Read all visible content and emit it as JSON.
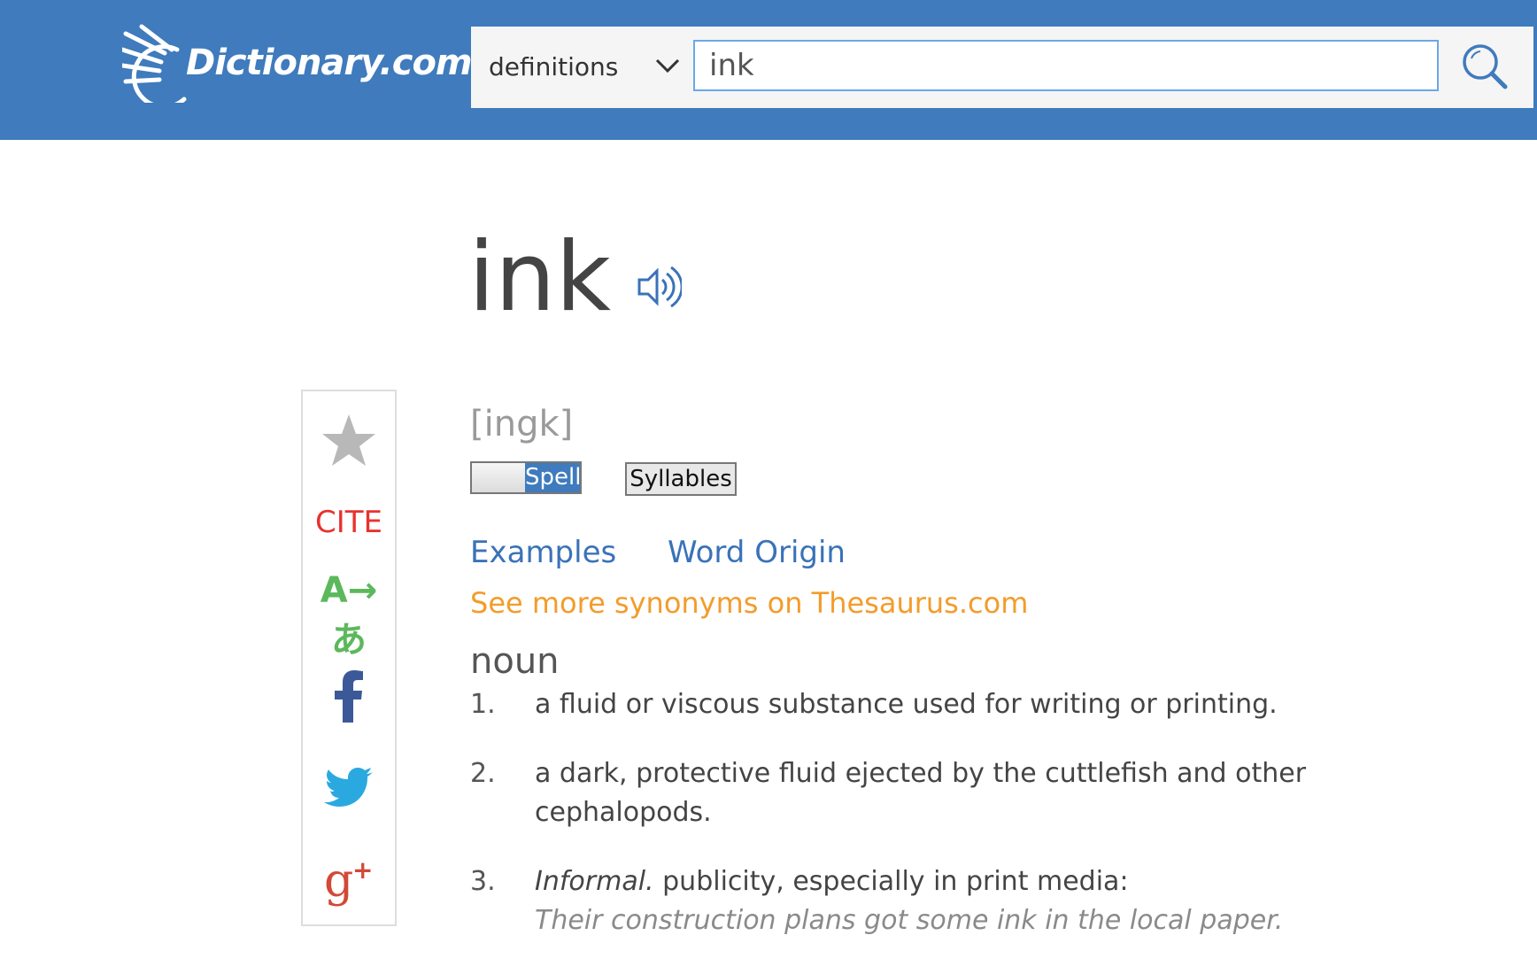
{
  "header": {
    "logo_text": "Dictionary.com",
    "search": {
      "mode_label": "definitions",
      "query": "ink"
    },
    "colors": {
      "background": "#3f7bbd"
    }
  },
  "entry": {
    "word": "ink",
    "pronunciation": "[ingk]",
    "spell_toggle_label": "Spell",
    "syllables_label": "Syllables",
    "tabs": [
      "Examples",
      "Word Origin"
    ],
    "thesaurus_link": "See more synonyms on Thesaurus.com",
    "part_of_speech": "noun",
    "definitions": [
      {
        "number": "1.",
        "text": "a fluid or viscous substance used for writing or printing."
      },
      {
        "number": "2.",
        "text": "a dark, protective fluid ejected by the cuttlefish and other cephalopods."
      },
      {
        "number": "3.",
        "label": "Informal.",
        "text": "publicity, especially in print media:",
        "example": "Their construction plans got some ink in the local paper."
      }
    ]
  },
  "share_panel": {
    "cite_label": "CITE",
    "translate_label": "A→あ",
    "icons": [
      "star-icon",
      "facebook-icon",
      "twitter-icon",
      "google-plus-icon"
    ]
  }
}
